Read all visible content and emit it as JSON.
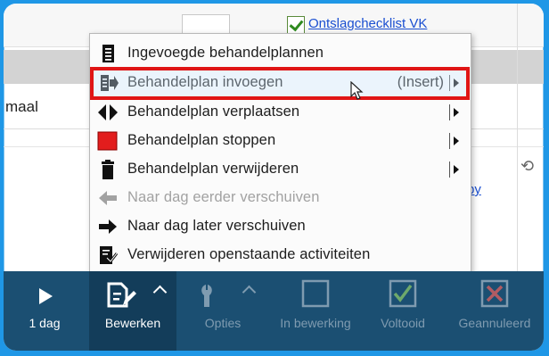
{
  "background": {
    "top_link": "Ontslagchecklist VK",
    "row_label": "maal",
    "right_link": "py"
  },
  "menu": {
    "items": [
      {
        "label": "Ingevoegde behandelplannen",
        "icon": "document-list-icon",
        "enabled": true
      },
      {
        "label": "Behandelplan invoegen",
        "shortcut": "(Insert)",
        "icon": "insert-icon",
        "enabled": true,
        "submenu": true,
        "highlighted": true
      },
      {
        "label": "Behandelplan verplaatsen",
        "icon": "move-icon",
        "enabled": true,
        "submenu": true
      },
      {
        "label": "Behandelplan stoppen",
        "icon": "stop-icon",
        "enabled": true,
        "submenu": true
      },
      {
        "label": "Behandelplan verwijderen",
        "icon": "trash-icon",
        "enabled": true,
        "submenu": true
      },
      {
        "label": "Naar dag eerder verschuiven",
        "icon": "arrow-left-icon",
        "enabled": false
      },
      {
        "label": "Naar dag later verschuiven",
        "icon": "arrow-right-icon",
        "enabled": true
      },
      {
        "label": "Verwijderen openstaande activiteiten",
        "icon": "remove-activities-icon",
        "enabled": true
      }
    ]
  },
  "toolbar": {
    "buttons": [
      {
        "label": "1 dag",
        "icon": "play-icon",
        "enabled": true
      },
      {
        "label": "Bewerken",
        "icon": "edit-icon",
        "enabled": true,
        "active": true
      },
      {
        "label": "Opties",
        "icon": "wrench-icon",
        "enabled": false
      },
      {
        "label": "In bewerking",
        "icon": "empty-checkbox-icon",
        "enabled": false
      },
      {
        "label": "Voltooid",
        "icon": "checked-box-icon",
        "enabled": false
      },
      {
        "label": "Geannuleerd",
        "icon": "cancelled-box-icon",
        "enabled": false
      }
    ]
  },
  "colors": {
    "highlight_border": "#e01515",
    "toolbar_bg": "#1b4f72",
    "frame_bg": "#1f97e6",
    "stop_red": "#e21d1d"
  }
}
